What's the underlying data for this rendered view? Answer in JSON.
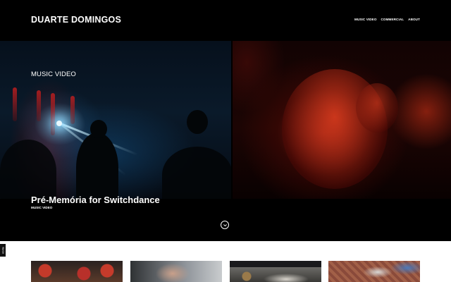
{
  "header": {
    "brand": "DUARTE DOMINGOS",
    "nav": [
      "MUSIC VIDEO",
      "COMMERCIAL",
      "ABOUT"
    ]
  },
  "hero": {
    "category": "MUSIC VIDEO",
    "title": "Pré-Memória for Switchdance",
    "subtitle": "MUSIC VIDEO"
  },
  "side_tab": "nbrite",
  "icons": {
    "scroll_down": "chevron-down-circle-icon"
  },
  "colors": {
    "background": "#000000",
    "text": "#ffffff",
    "lower_section": "#ffffff"
  }
}
